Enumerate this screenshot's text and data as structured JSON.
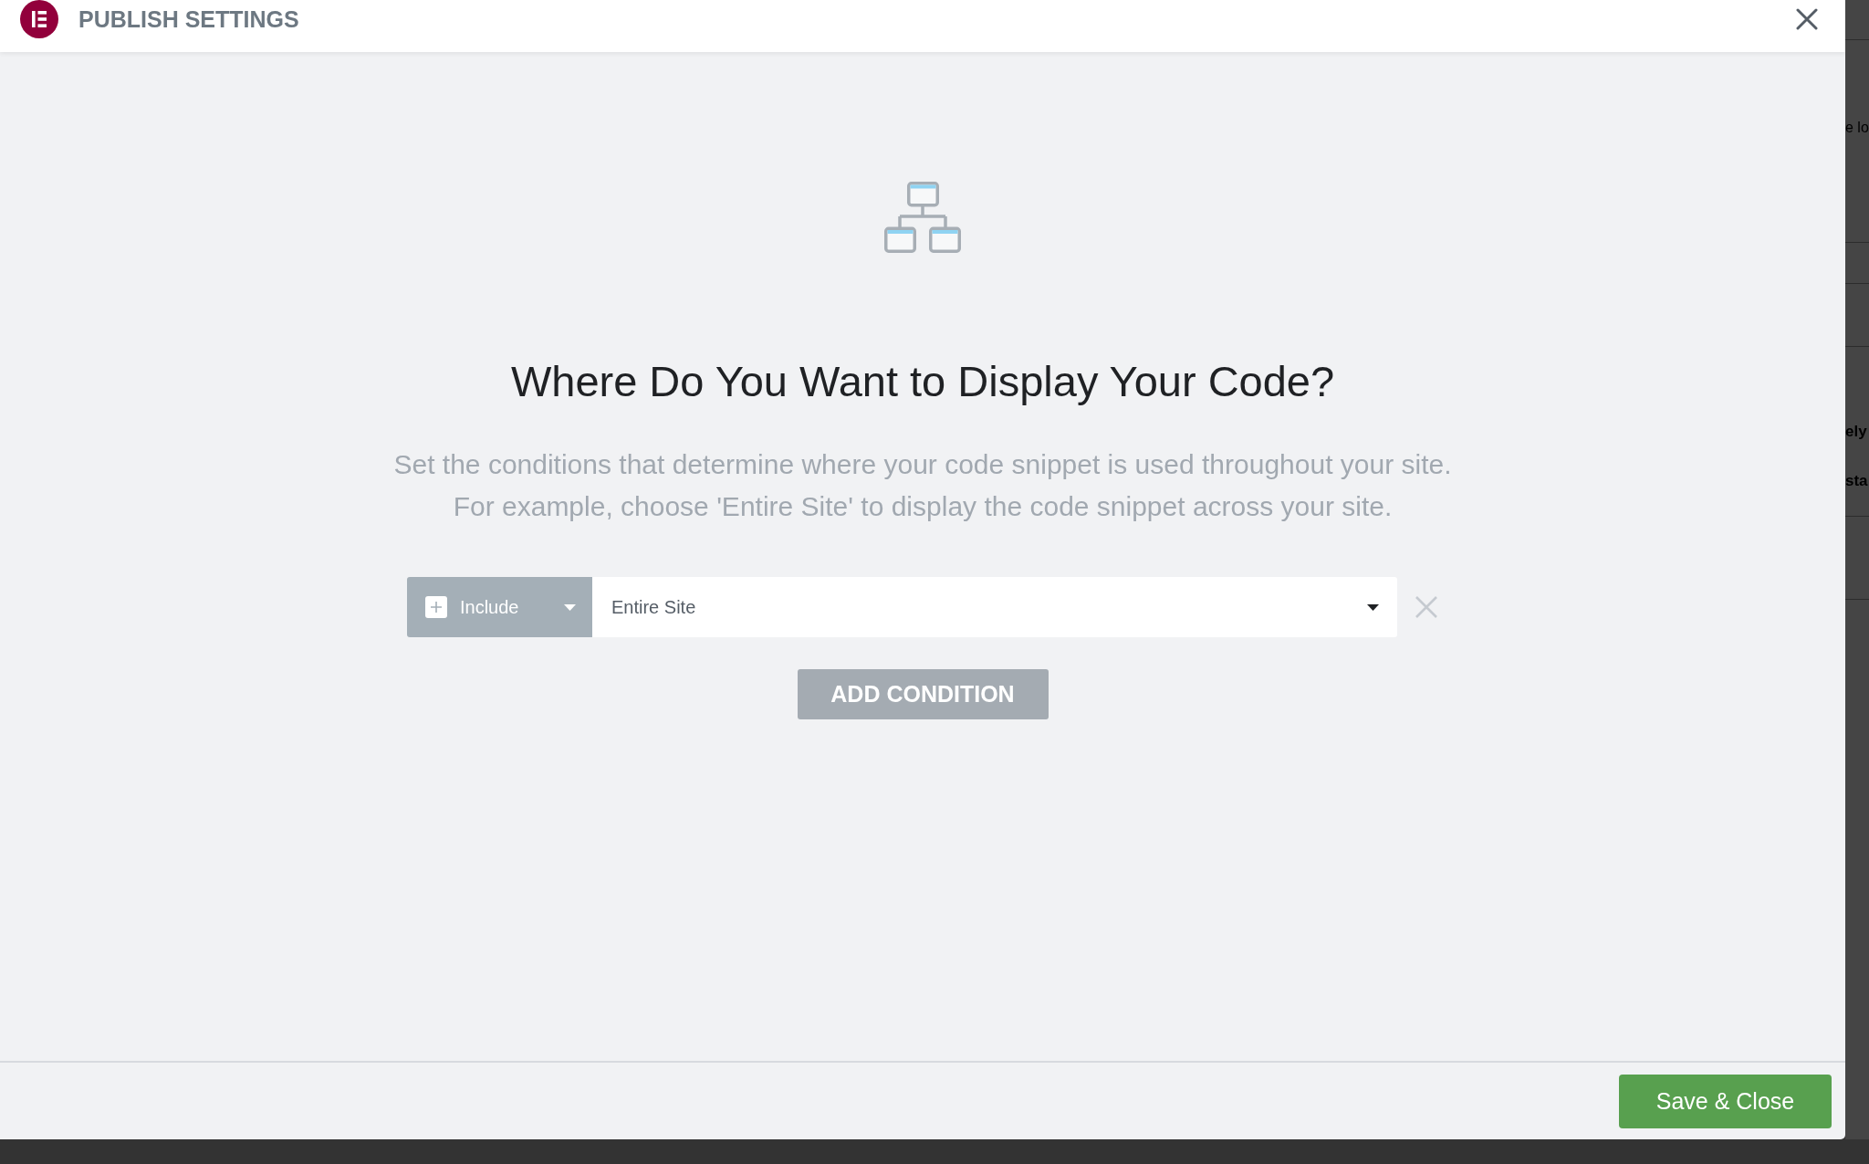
{
  "dialog": {
    "title": "PUBLISH SETTINGS"
  },
  "heading": "Where Do You Want to Display Your Code?",
  "description": [
    "Set the conditions that determine where your code snippet is used throughout your site.",
    "For example, choose 'Entire Site' to display the code snippet across your site."
  ],
  "conditions": [
    {
      "type": "Include",
      "value": "Entire Site"
    }
  ],
  "add_button": "ADD CONDITION",
  "footer": {
    "save_button": "Save & Close"
  },
  "background_page": {
    "texts": [
      {
        "text": "e lo",
        "kind": "plain"
      },
      {
        "text": "ely",
        "kind": "strong"
      },
      {
        "text": "sta",
        "kind": "strong"
      }
    ]
  }
}
